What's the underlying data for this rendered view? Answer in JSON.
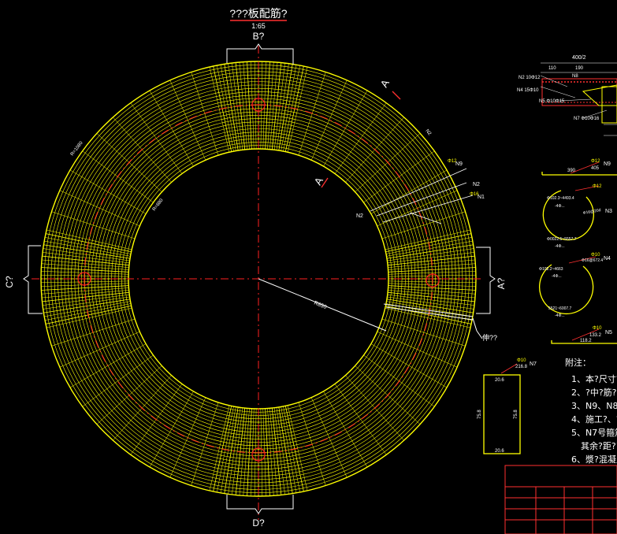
{
  "drawing": {
    "title": "???板配筋?",
    "scale": "1:65",
    "view_top": "B?",
    "view_bottom": "D?",
    "view_left": "C?",
    "view_right": "A?",
    "section_mark": "A",
    "joint_label": "伸??",
    "radius_label": "R850",
    "left_label_1": "R=1080",
    "left_label_2": "R=880"
  },
  "rebar_labels": {
    "n9": "N9",
    "n2a": "N2",
    "n1": "N1",
    "n2b": "N2",
    "d12": "Φ12",
    "d16": "Φ16",
    "n2c": "N2",
    "n3": "N3",
    "n4": "N4",
    "n5": "N5",
    "n7": "N7",
    "n8": "N8"
  },
  "section_detail": {
    "top_dim": "400/2",
    "labels": [
      "N2 10Φ12",
      "N4 15Φ10",
      "N5 Φ10Φ15",
      "N8",
      "N7 Φ10Φ16"
    ],
    "dim_left": "110",
    "dim_mid": "190"
  },
  "bar_shapes": {
    "n9": {
      "dia": "Φ12",
      "len": "405",
      "name": "N9",
      "dim": "390"
    },
    "circle1": {
      "dia": "Φ12",
      "spacing": "Φ16@20d",
      "inner": "Φ102.3~4493.4",
      "lbl": "-4Φ...",
      "outer": "Φ0022.5~5557.7",
      "n": "N3"
    },
    "circle2": {
      "dia": "Φ10",
      "spacing": "Φ16@672.4",
      "inner": "Φ102.2~4663",
      "lbl": "-4Φ...",
      "outer": "5521~6007.7",
      "n": "N4"
    },
    "n5": {
      "dia": "Φ10",
      "len": "133.2",
      "dim": "118.2",
      "name": "N5"
    },
    "n7": {
      "dia": "Φ10",
      "len": "216.8",
      "name": "N7",
      "top": "20.6",
      "bottom": "20.6",
      "left": "75.8",
      "right": "75.8"
    }
  },
  "notes": {
    "heading": "附注：",
    "items": [
      "1、本?尺寸?位",
      "2、?中?筋?",
      "3、N9、N8号",
      "4、施工?、?筋",
      "5、N7号箍筋在",
      "其余?距?15",
      "6、漿?混凝土截"
    ]
  },
  "colors": {
    "background": "#000000",
    "rebar": "#ffff00",
    "centerline": "#ff0000",
    "text": "#ffffff",
    "annotation": "#ff0000"
  }
}
